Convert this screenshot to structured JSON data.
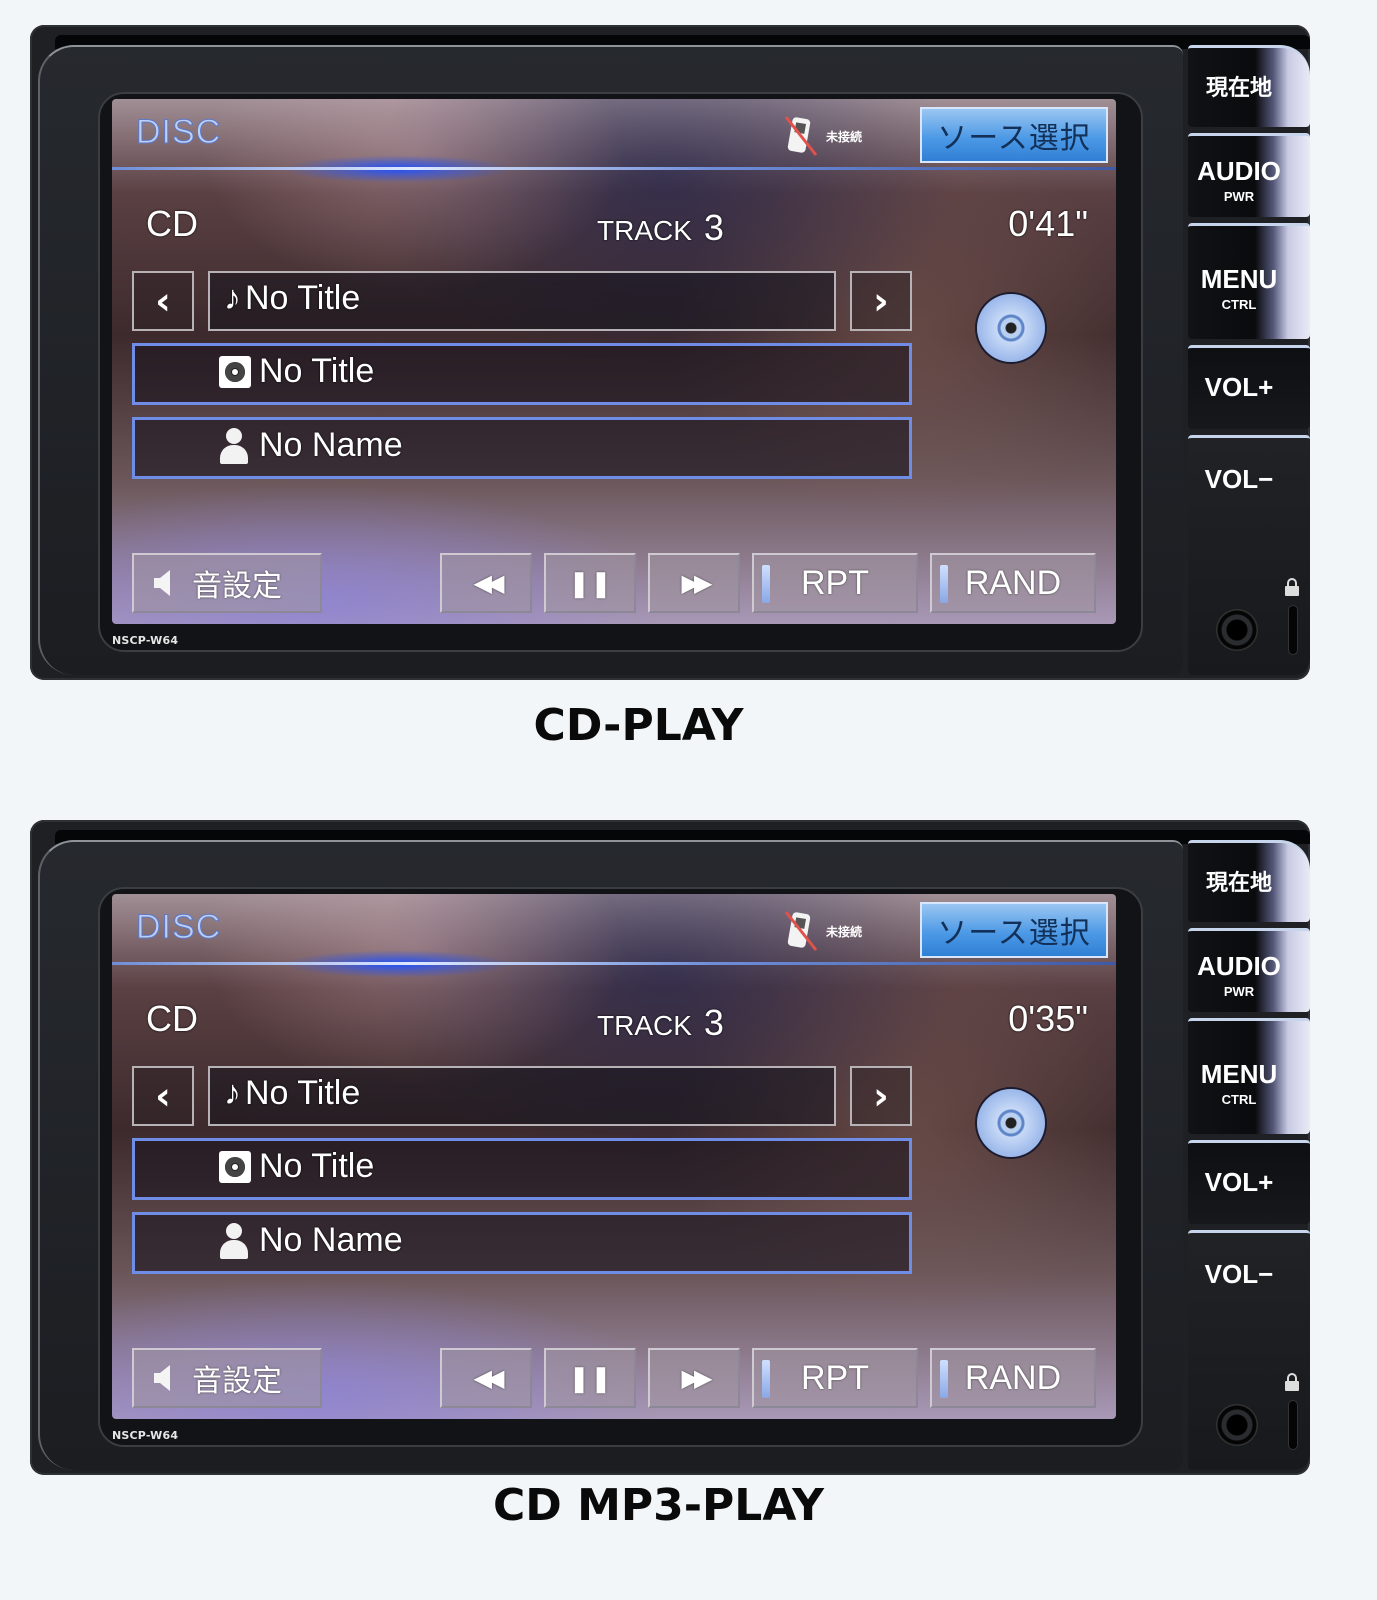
{
  "units": [
    {
      "screen": {
        "mode_label": "DISC",
        "phone_status": {
          "icon": "phone-disconnected-icon",
          "text": "未接続"
        },
        "source_button": "ソース選択",
        "source_name": "CD",
        "track_label": "TRACK",
        "track_number": "3",
        "elapsed_time": "0'41\"",
        "song_title": {
          "icon": "music-note-icon",
          "glyph": "♪",
          "text": "No Title"
        },
        "album_title": {
          "icon": "album-icon",
          "text": "No Title"
        },
        "artist_name": {
          "icon": "person-icon",
          "text": "No Name"
        },
        "prev_glyph": "‹",
        "next_glyph": "›",
        "controls": {
          "sound_settings": "音設定",
          "rewind": "◀◀",
          "pause": "❚❚",
          "fast_forward": "▶▶",
          "repeat": "RPT",
          "random": "RAND"
        }
      },
      "hardware_buttons": [
        {
          "label": "現在地",
          "sub": ""
        },
        {
          "label": "AUDIO",
          "sub": "PWR"
        },
        {
          "label": "MENU",
          "sub": "CTRL"
        },
        {
          "label": "VOL+",
          "sub": ""
        },
        {
          "label": "VOL−",
          "sub": ""
        }
      ],
      "model": "NSCP-W64",
      "caption": "CD-PLAY"
    },
    {
      "screen": {
        "mode_label": "DISC",
        "phone_status": {
          "icon": "phone-disconnected-icon",
          "text": "未接続"
        },
        "source_button": "ソース選択",
        "source_name": "CD",
        "track_label": "TRACK",
        "track_number": "3",
        "elapsed_time": "0'35\"",
        "song_title": {
          "icon": "music-note-icon",
          "glyph": "♪",
          "text": "No Title"
        },
        "album_title": {
          "icon": "album-icon",
          "text": "No Title"
        },
        "artist_name": {
          "icon": "person-icon",
          "text": "No Name"
        },
        "prev_glyph": "‹",
        "next_glyph": "›",
        "controls": {
          "sound_settings": "音設定",
          "rewind": "◀◀",
          "pause": "❚❚",
          "fast_forward": "▶▶",
          "repeat": "RPT",
          "random": "RAND"
        }
      },
      "hardware_buttons": [
        {
          "label": "現在地",
          "sub": ""
        },
        {
          "label": "AUDIO",
          "sub": "PWR"
        },
        {
          "label": "MENU",
          "sub": "CTRL"
        },
        {
          "label": "VOL+",
          "sub": ""
        },
        {
          "label": "VOL−",
          "sub": ""
        }
      ],
      "model": "NSCP-W64",
      "caption": "CD MP3-PLAY"
    }
  ],
  "colors": {
    "accent_blue": "#4d9ae6",
    "box_border_blue": "#6f8de6",
    "label_blue": "#bcd0f6"
  }
}
